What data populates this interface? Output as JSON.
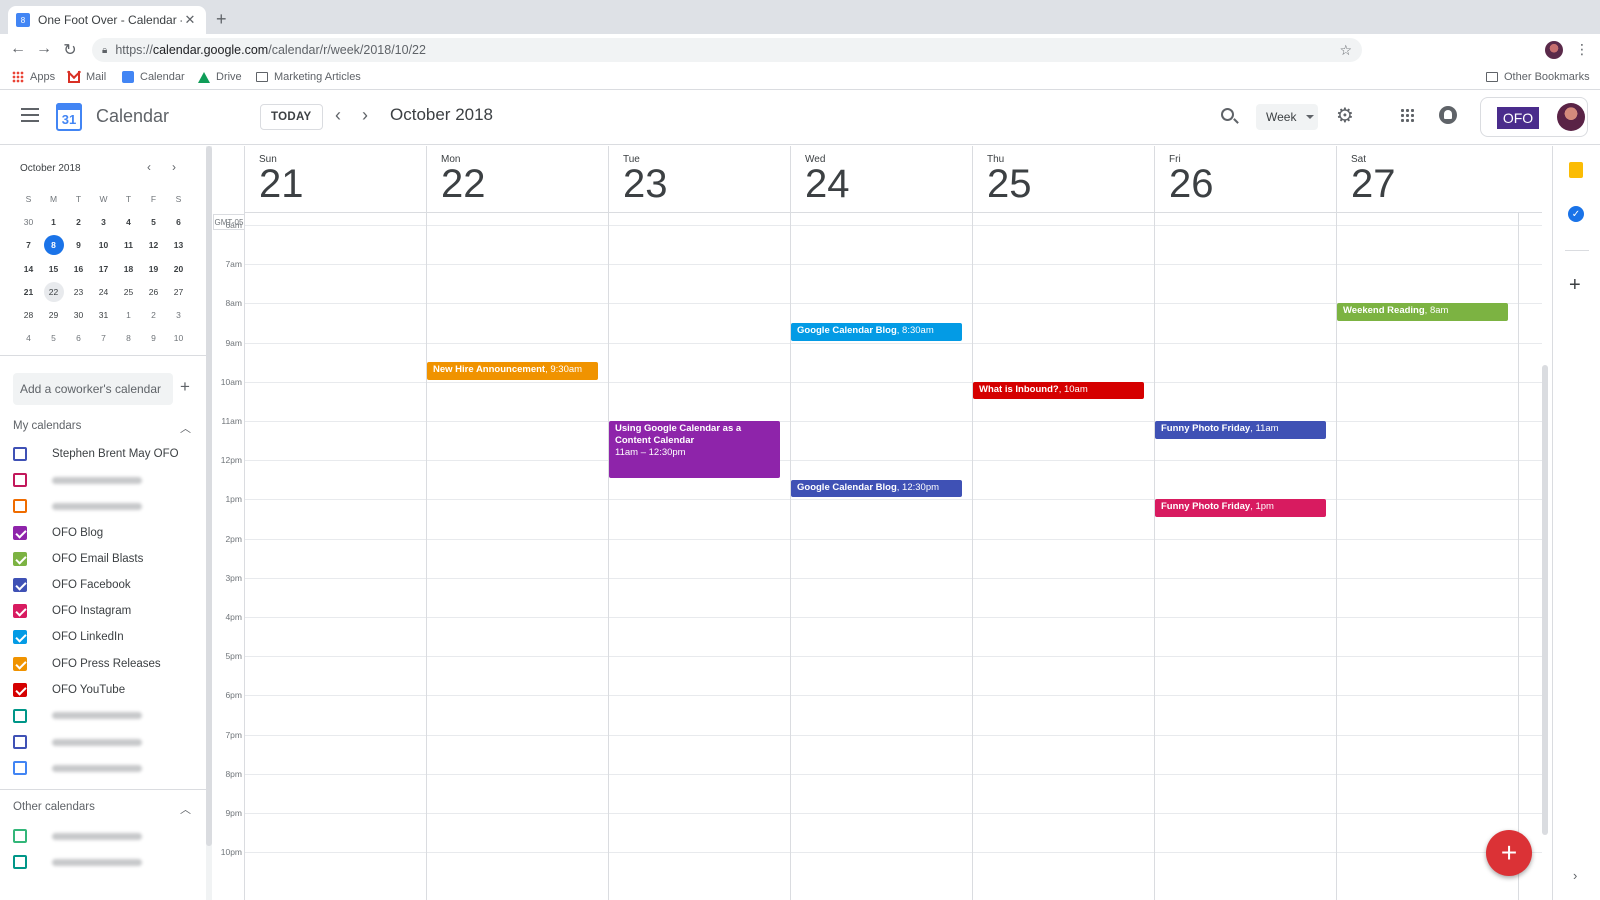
{
  "browser": {
    "tab_title": "One Foot Over - Calendar - We",
    "tab_favicon": "8",
    "url_prefix": "https://",
    "url_domain": "calendar.google.com",
    "url_path": "/calendar/r/week/2018/10/22",
    "bookmarks": [
      {
        "label": "Apps",
        "icon": "apps-grid-icon"
      },
      {
        "label": "Mail",
        "icon": "gmail-icon"
      },
      {
        "label": "Calendar",
        "icon": "calendar-icon"
      },
      {
        "label": "Drive",
        "icon": "drive-icon"
      },
      {
        "label": "Marketing Articles",
        "icon": "folder-icon"
      }
    ],
    "other_bookmarks": "Other Bookmarks"
  },
  "header": {
    "app_name": "Calendar",
    "logo_day": "31",
    "today_label": "TODAY",
    "title": "October 2018",
    "view_label": "Week",
    "account_badge": "OFO"
  },
  "mini_calendar": {
    "title": "October 2018",
    "dow": [
      "S",
      "M",
      "T",
      "W",
      "T",
      "F",
      "S"
    ],
    "weeks": [
      [
        "30",
        "1",
        "2",
        "3",
        "4",
        "5",
        "6"
      ],
      [
        "7",
        "8",
        "9",
        "10",
        "11",
        "12",
        "13"
      ],
      [
        "14",
        "15",
        "16",
        "17",
        "18",
        "19",
        "20"
      ],
      [
        "21",
        "22",
        "23",
        "24",
        "25",
        "26",
        "27"
      ],
      [
        "28",
        "29",
        "30",
        "31",
        "1",
        "2",
        "3"
      ],
      [
        "4",
        "5",
        "6",
        "7",
        "8",
        "9",
        "10"
      ]
    ],
    "today": "8",
    "selected": "22"
  },
  "sidebar": {
    "add_coworker_placeholder": "Add a coworker's calendar",
    "my_calendars_label": "My calendars",
    "my_calendars": [
      {
        "label": "Stephen Brent May OFO",
        "color": "#3f51b5",
        "checked": false,
        "blurred": false
      },
      {
        "label": "",
        "color": "#c2185b",
        "checked": false,
        "blurred": true
      },
      {
        "label": "",
        "color": "#ef6c00",
        "checked": false,
        "blurred": true
      },
      {
        "label": "OFO Blog",
        "color": "#8e24aa",
        "checked": true,
        "blurred": false
      },
      {
        "label": "OFO Email Blasts",
        "color": "#7cb342",
        "checked": true,
        "blurred": false
      },
      {
        "label": "OFO Facebook",
        "color": "#3f51b5",
        "checked": true,
        "blurred": false
      },
      {
        "label": "OFO Instagram",
        "color": "#d81b60",
        "checked": true,
        "blurred": false
      },
      {
        "label": "OFO LinkedIn",
        "color": "#039be5",
        "checked": true,
        "blurred": false
      },
      {
        "label": "OFO Press Releases",
        "color": "#f09300",
        "checked": true,
        "blurred": false
      },
      {
        "label": "OFO YouTube",
        "color": "#d50000",
        "checked": true,
        "blurred": false
      },
      {
        "label": "",
        "color": "#009688",
        "checked": false,
        "blurred": true
      },
      {
        "label": "",
        "color": "#3f51b5",
        "checked": false,
        "blurred": true
      },
      {
        "label": "",
        "color": "#4285f4",
        "checked": false,
        "blurred": true
      }
    ],
    "other_calendars_label": "Other calendars",
    "other_calendars": [
      {
        "label": "",
        "color": "#33b679",
        "checked": false,
        "blurred": true
      },
      {
        "label": "",
        "color": "#009688",
        "checked": false,
        "blurred": true
      }
    ]
  },
  "week": {
    "timezone": "GMT-05",
    "days": [
      {
        "name": "Sun",
        "date": "21"
      },
      {
        "name": "Mon",
        "date": "22"
      },
      {
        "name": "Tue",
        "date": "23"
      },
      {
        "name": "Wed",
        "date": "24"
      },
      {
        "name": "Thu",
        "date": "25"
      },
      {
        "name": "Fri",
        "date": "26"
      },
      {
        "name": "Sat",
        "date": "27"
      }
    ],
    "hours": [
      "6am",
      "7am",
      "8am",
      "9am",
      "10am",
      "11am",
      "12pm",
      "1pm",
      "2pm",
      "3pm",
      "4pm",
      "5pm",
      "6pm",
      "7pm",
      "8pm",
      "9pm",
      "10pm"
    ],
    "events": [
      {
        "day": 1,
        "title": "New Hire Announcement",
        "time": "9:30am",
        "start": 9.5,
        "end": 10,
        "color": "#f09300"
      },
      {
        "day": 2,
        "title": "Using Google Calendar as a Content Calendar",
        "time": "11am – 12:30pm",
        "start": 11,
        "end": 12.5,
        "color": "#8e24aa",
        "multiline": true
      },
      {
        "day": 3,
        "title": "Google Calendar Blog",
        "time": "8:30am",
        "start": 8.5,
        "end": 9,
        "color": "#039be5"
      },
      {
        "day": 3,
        "title": "Google Calendar Blog",
        "time": "12:30pm",
        "start": 12.5,
        "end": 13,
        "color": "#3f51b5"
      },
      {
        "day": 4,
        "title": "What is Inbound?",
        "time": "10am",
        "start": 10,
        "end": 10.5,
        "color": "#d50000"
      },
      {
        "day": 5,
        "title": "Funny Photo Friday",
        "time": "11am",
        "start": 11,
        "end": 11.5,
        "color": "#3f51b5"
      },
      {
        "day": 5,
        "title": "Funny Photo Friday",
        "time": "1pm",
        "start": 13,
        "end": 13.5,
        "color": "#d81b60"
      },
      {
        "day": 6,
        "title": "Weekend Reading",
        "time": "8am",
        "start": 8,
        "end": 8.5,
        "color": "#7cb342"
      }
    ]
  },
  "fab_label": "+"
}
